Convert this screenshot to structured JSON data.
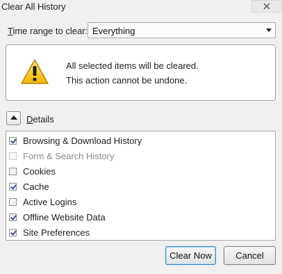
{
  "window": {
    "title": "Clear All History",
    "close_icon": "close-icon"
  },
  "time_range": {
    "label_prefix": "",
    "label_accel": "T",
    "label_rest": "ime range to clear:",
    "selected": "Everything"
  },
  "warning": {
    "icon": "warning-triangle-icon",
    "line1": "All selected items will be cleared.",
    "line2": "This action cannot be undone."
  },
  "details": {
    "label_accel": "D",
    "label_rest": "etails",
    "expanded": true
  },
  "items": [
    {
      "label": "Browsing & Download History",
      "checked": true,
      "disabled": false
    },
    {
      "label": "Form & Search History",
      "checked": false,
      "disabled": true
    },
    {
      "label": "Cookies",
      "checked": false,
      "disabled": false
    },
    {
      "label": "Cache",
      "checked": true,
      "disabled": false
    },
    {
      "label": "Active Logins",
      "checked": false,
      "disabled": false
    },
    {
      "label": "Offline Website Data",
      "checked": true,
      "disabled": false
    },
    {
      "label": "Site Preferences",
      "checked": true,
      "disabled": false
    }
  ],
  "buttons": {
    "clear_now": "Clear Now",
    "cancel": "Cancel"
  },
  "colors": {
    "warning_yellow": "#f5c400",
    "check_blue": "#3d4e8f",
    "default_button_border": "#3c7fb1"
  }
}
